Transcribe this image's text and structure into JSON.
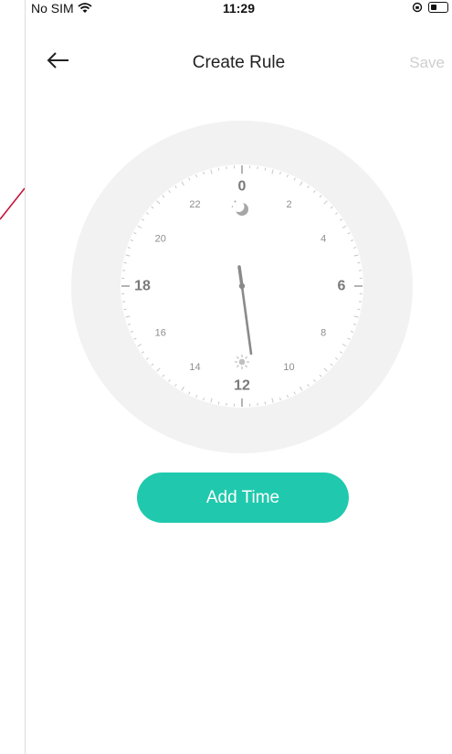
{
  "status_bar": {
    "carrier": "No SIM",
    "time": "11:29"
  },
  "nav": {
    "title": "Create Rule",
    "save_label": "Save"
  },
  "clock": {
    "hour_labels": [
      "0",
      "2",
      "4",
      "6",
      "8",
      "10",
      "12",
      "14",
      "16",
      "18",
      "20",
      "22"
    ],
    "major_hours": [
      "0",
      "6",
      "12",
      "18"
    ],
    "hand_time": "11:29",
    "colors": {
      "ring": "#f2f2f2",
      "face": "#ffffff",
      "text": "#7a7a7a",
      "tick": "#c6c6c6",
      "hand": "#8a8a8a"
    }
  },
  "add_time_label": "Add Time",
  "colors": {
    "accent": "#20c9ad",
    "save_disabled": "#cfcfcf"
  },
  "icons": {
    "back": "arrow-left-icon",
    "wifi": "wifi-icon",
    "lock_rotation": "rotation-lock-icon",
    "battery": "battery-icon",
    "night": "moon-icon",
    "day": "sun-icon"
  }
}
